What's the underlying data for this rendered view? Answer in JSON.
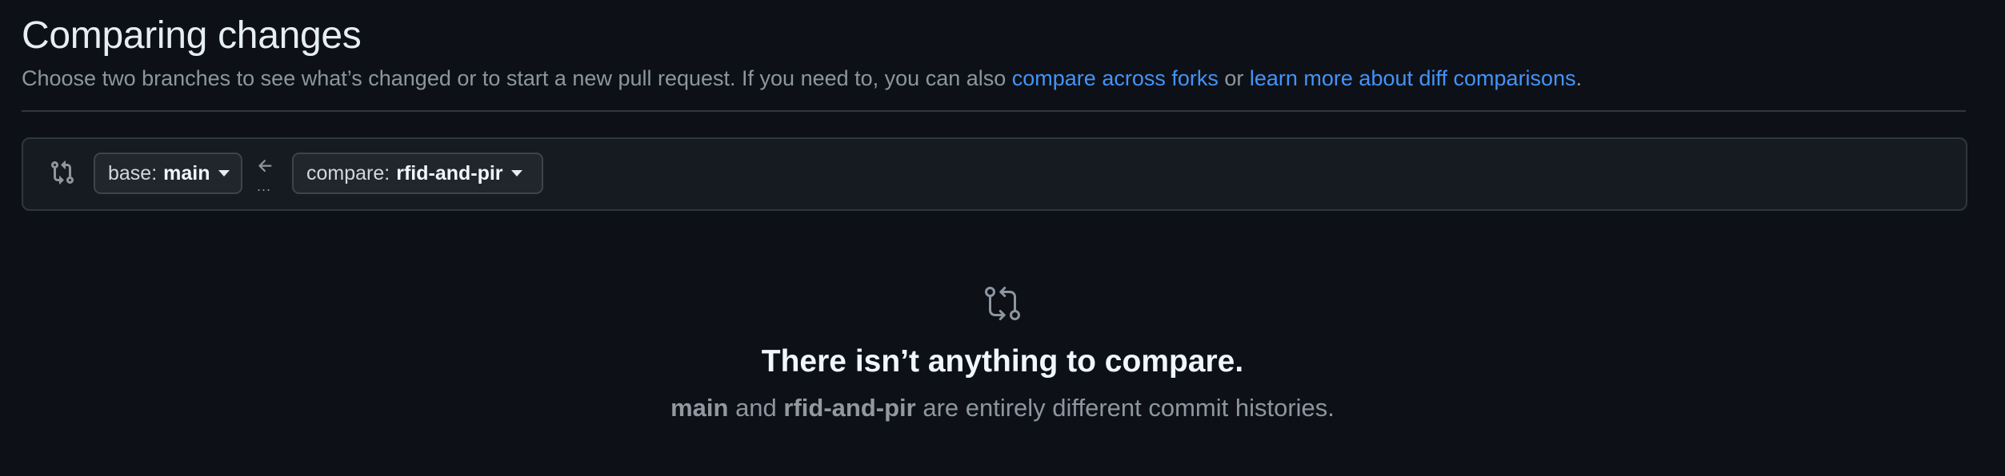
{
  "page": {
    "title": "Comparing changes",
    "subtitle_prefix": "Choose two branches to see what’s changed or to start a new pull request. If you need to, you can also ",
    "link_forks": "compare across forks",
    "subtitle_mid": " or ",
    "link_learn": "learn more about diff comparisons",
    "subtitle_suffix": "."
  },
  "range": {
    "icon": "git-compare-icon",
    "base_prefix": "base:",
    "base_branch": "main",
    "arrow_icon": "arrow-left-icon",
    "dots": "...",
    "compare_prefix": "compare:",
    "compare_branch": "rfid-and-pir"
  },
  "blankslate": {
    "icon": "git-compare-icon",
    "title": "There isn’t anything to compare.",
    "branch_a": "main",
    "and_text": " and ",
    "branch_b": "rfid-and-pir",
    "desc_suffix": " are entirely different commit histories."
  },
  "colors": {
    "background": "#0d1117",
    "link": "#4493f8",
    "muted": "#8d96a0",
    "border": "#30363d"
  }
}
